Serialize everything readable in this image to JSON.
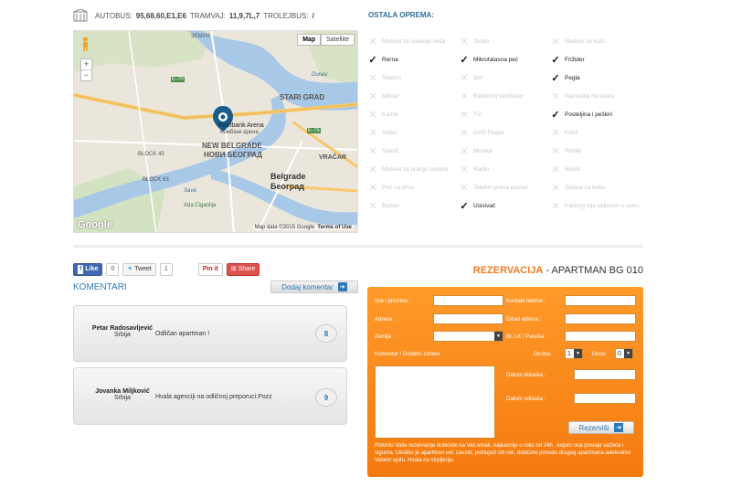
{
  "transport": {
    "bus_label": "AUTOBUS:",
    "bus_lines": "95,68,60,E1,E6",
    "tram_label": "TRAMVAJ:",
    "tram_lines": "11,9,7L,7",
    "trolley_label": "TROLEJBUS:",
    "trolley_lines": "/"
  },
  "map": {
    "map_button": "Map",
    "satellite_button": "Satellite",
    "zoom_in": "+",
    "zoom_out": "−",
    "logo": "Google",
    "footer": "Map data ©2015 Google",
    "terms": "Terms of Use",
    "labels": {
      "zemun": "ЗЕМУН",
      "stari_grad": "STARI GRAD",
      "new_belgrade": "NEW BELGRADE",
      "novi_beograd": "НОВИ БЕОГРАД",
      "belgrade": "Belgrade",
      "beograd": "Београд",
      "vracar": "VRAČAR",
      "arena": "Kombank Arena",
      "arena_cyr": "Комбанк арена",
      "road_e70": "E-70",
      "road_e75": "E-75",
      "block_45": "BLOCK 45",
      "block_63": "BLOCK 63",
      "sava": "Sava",
      "dunav": "Dunav",
      "ada": "Ada Ciganlija"
    }
  },
  "equipment": {
    "title": "OSTALA OPREMA:",
    "items": [
      {
        "label": "Mašina za sušenje veša",
        "available": false
      },
      {
        "label": "Toster",
        "available": false
      },
      {
        "label": "Mašina za kafu",
        "available": false
      },
      {
        "label": "Rerna",
        "available": true
      },
      {
        "label": "Mikrotalasna peć",
        "available": true
      },
      {
        "label": "Frižider",
        "available": true
      },
      {
        "label": "Telefon",
        "available": false
      },
      {
        "label": "Sef",
        "available": false
      },
      {
        "label": "Pegla",
        "available": true
      },
      {
        "label": "Mikser",
        "available": false
      },
      {
        "label": "Električni ventilator",
        "available": false
      },
      {
        "label": "Nameštaj na terasi",
        "available": false
      },
      {
        "label": "Kamin",
        "available": false
      },
      {
        "label": "TV",
        "available": false
      },
      {
        "label": "Posteljina i peškiri",
        "available": true
      },
      {
        "label": "Video",
        "available": false
      },
      {
        "label": "DVD Player",
        "available": false
      },
      {
        "label": "Fotrir",
        "available": false
      },
      {
        "label": "Satelit",
        "available": false
      },
      {
        "label": "Muzika",
        "available": false
      },
      {
        "label": "Roštilj",
        "available": false
      },
      {
        "label": "Mašina za pranje sudova",
        "available": false
      },
      {
        "label": "Radio",
        "available": false
      },
      {
        "label": "Biciklí",
        "available": false
      },
      {
        "label": "Peć na drva",
        "available": false
      },
      {
        "label": "Telefon prima pozive",
        "available": false
      },
      {
        "label": "Stolica za bebu",
        "available": false
      },
      {
        "label": "Bazen",
        "available": false
      },
      {
        "label": "Usisivač",
        "available": true
      },
      {
        "label": "Parking nije uključen u cenu",
        "available": false
      }
    ]
  },
  "social": {
    "like": "Like",
    "like_count": "0",
    "tweet": "Tweet",
    "tweet_count": "1",
    "pin": "Pin it",
    "share": "Share"
  },
  "comments": {
    "title": "KOMENTARI",
    "add_button": "Dodaj komentar",
    "items": [
      {
        "author": "Petar Radosavljević",
        "country": "Srbija",
        "text": "Odličan apartman !",
        "score": "8"
      },
      {
        "author": "Jovanka Miljković",
        "country": "Srbija",
        "text": "Hvala agenciji na odličnoj preporuci.Pozz",
        "score": "9"
      }
    ]
  },
  "reservation": {
    "title_orange": "REZERVACIJA",
    "title_rest": " - APARTMAN BG 010",
    "fields": {
      "name": "Ime i prezime :",
      "phone": "Kontakt telefon :",
      "address": "Adresa :",
      "email": "Email adresa :",
      "country": "Zemlja :",
      "id_number": "Br. LK / Pasoša :",
      "comment": "Komentar / Dodatni zahtev:",
      "persons": "Osoba:",
      "children": "Dece:",
      "arrival": "Datum dolaska :",
      "departure": "Datum odlaska :"
    },
    "persons_value": "1",
    "children_value": "0",
    "submit": "Rezerviši",
    "note": "Potvrdu Vaše rezervacije dobićete na Vaš email, najkasnije u roku od 24h , kojom ona postaje važeća i sigurna. Ukoliko je apartman već zauzet, poštujući isti rok, dobićete ponudu drugog apartmana adekvatno Vašem upitu. Hvala na strpljenju."
  }
}
